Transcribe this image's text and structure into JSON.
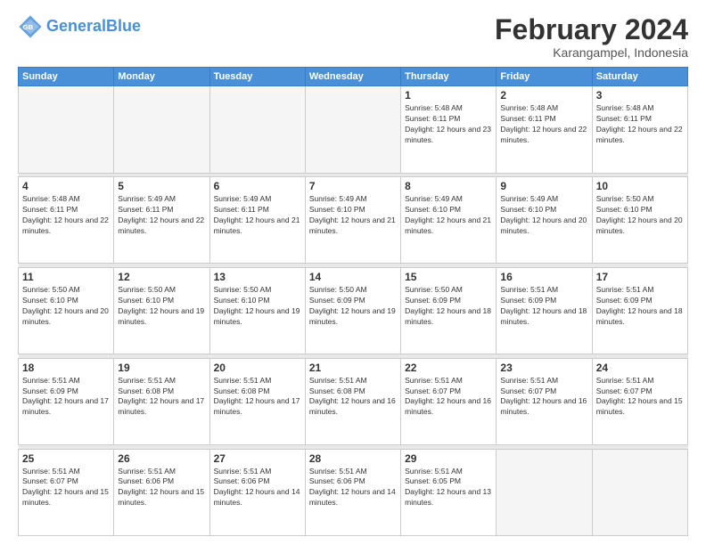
{
  "header": {
    "logo_general": "General",
    "logo_blue": "Blue",
    "month_title": "February 2024",
    "location": "Karangampel, Indonesia"
  },
  "weekdays": [
    "Sunday",
    "Monday",
    "Tuesday",
    "Wednesday",
    "Thursday",
    "Friday",
    "Saturday"
  ],
  "weeks": [
    [
      {
        "day": "",
        "empty": true
      },
      {
        "day": "",
        "empty": true
      },
      {
        "day": "",
        "empty": true
      },
      {
        "day": "",
        "empty": true
      },
      {
        "day": "1",
        "sunrise": "5:48 AM",
        "sunset": "6:11 PM",
        "daylight": "12 hours and 23 minutes."
      },
      {
        "day": "2",
        "sunrise": "5:48 AM",
        "sunset": "6:11 PM",
        "daylight": "12 hours and 22 minutes."
      },
      {
        "day": "3",
        "sunrise": "5:48 AM",
        "sunset": "6:11 PM",
        "daylight": "12 hours and 22 minutes."
      }
    ],
    [
      {
        "day": "4",
        "sunrise": "5:48 AM",
        "sunset": "6:11 PM",
        "daylight": "12 hours and 22 minutes."
      },
      {
        "day": "5",
        "sunrise": "5:49 AM",
        "sunset": "6:11 PM",
        "daylight": "12 hours and 22 minutes."
      },
      {
        "day": "6",
        "sunrise": "5:49 AM",
        "sunset": "6:11 PM",
        "daylight": "12 hours and 21 minutes."
      },
      {
        "day": "7",
        "sunrise": "5:49 AM",
        "sunset": "6:10 PM",
        "daylight": "12 hours and 21 minutes."
      },
      {
        "day": "8",
        "sunrise": "5:49 AM",
        "sunset": "6:10 PM",
        "daylight": "12 hours and 21 minutes."
      },
      {
        "day": "9",
        "sunrise": "5:49 AM",
        "sunset": "6:10 PM",
        "daylight": "12 hours and 20 minutes."
      },
      {
        "day": "10",
        "sunrise": "5:50 AM",
        "sunset": "6:10 PM",
        "daylight": "12 hours and 20 minutes."
      }
    ],
    [
      {
        "day": "11",
        "sunrise": "5:50 AM",
        "sunset": "6:10 PM",
        "daylight": "12 hours and 20 minutes."
      },
      {
        "day": "12",
        "sunrise": "5:50 AM",
        "sunset": "6:10 PM",
        "daylight": "12 hours and 19 minutes."
      },
      {
        "day": "13",
        "sunrise": "5:50 AM",
        "sunset": "6:10 PM",
        "daylight": "12 hours and 19 minutes."
      },
      {
        "day": "14",
        "sunrise": "5:50 AM",
        "sunset": "6:09 PM",
        "daylight": "12 hours and 19 minutes."
      },
      {
        "day": "15",
        "sunrise": "5:50 AM",
        "sunset": "6:09 PM",
        "daylight": "12 hours and 18 minutes."
      },
      {
        "day": "16",
        "sunrise": "5:51 AM",
        "sunset": "6:09 PM",
        "daylight": "12 hours and 18 minutes."
      },
      {
        "day": "17",
        "sunrise": "5:51 AM",
        "sunset": "6:09 PM",
        "daylight": "12 hours and 18 minutes."
      }
    ],
    [
      {
        "day": "18",
        "sunrise": "5:51 AM",
        "sunset": "6:09 PM",
        "daylight": "12 hours and 17 minutes."
      },
      {
        "day": "19",
        "sunrise": "5:51 AM",
        "sunset": "6:08 PM",
        "daylight": "12 hours and 17 minutes."
      },
      {
        "day": "20",
        "sunrise": "5:51 AM",
        "sunset": "6:08 PM",
        "daylight": "12 hours and 17 minutes."
      },
      {
        "day": "21",
        "sunrise": "5:51 AM",
        "sunset": "6:08 PM",
        "daylight": "12 hours and 16 minutes."
      },
      {
        "day": "22",
        "sunrise": "5:51 AM",
        "sunset": "6:07 PM",
        "daylight": "12 hours and 16 minutes."
      },
      {
        "day": "23",
        "sunrise": "5:51 AM",
        "sunset": "6:07 PM",
        "daylight": "12 hours and 16 minutes."
      },
      {
        "day": "24",
        "sunrise": "5:51 AM",
        "sunset": "6:07 PM",
        "daylight": "12 hours and 15 minutes."
      }
    ],
    [
      {
        "day": "25",
        "sunrise": "5:51 AM",
        "sunset": "6:07 PM",
        "daylight": "12 hours and 15 minutes."
      },
      {
        "day": "26",
        "sunrise": "5:51 AM",
        "sunset": "6:06 PM",
        "daylight": "12 hours and 15 minutes."
      },
      {
        "day": "27",
        "sunrise": "5:51 AM",
        "sunset": "6:06 PM",
        "daylight": "12 hours and 14 minutes."
      },
      {
        "day": "28",
        "sunrise": "5:51 AM",
        "sunset": "6:06 PM",
        "daylight": "12 hours and 14 minutes."
      },
      {
        "day": "29",
        "sunrise": "5:51 AM",
        "sunset": "6:05 PM",
        "daylight": "12 hours and 13 minutes."
      },
      {
        "day": "",
        "empty": true
      },
      {
        "day": "",
        "empty": true
      }
    ]
  ]
}
